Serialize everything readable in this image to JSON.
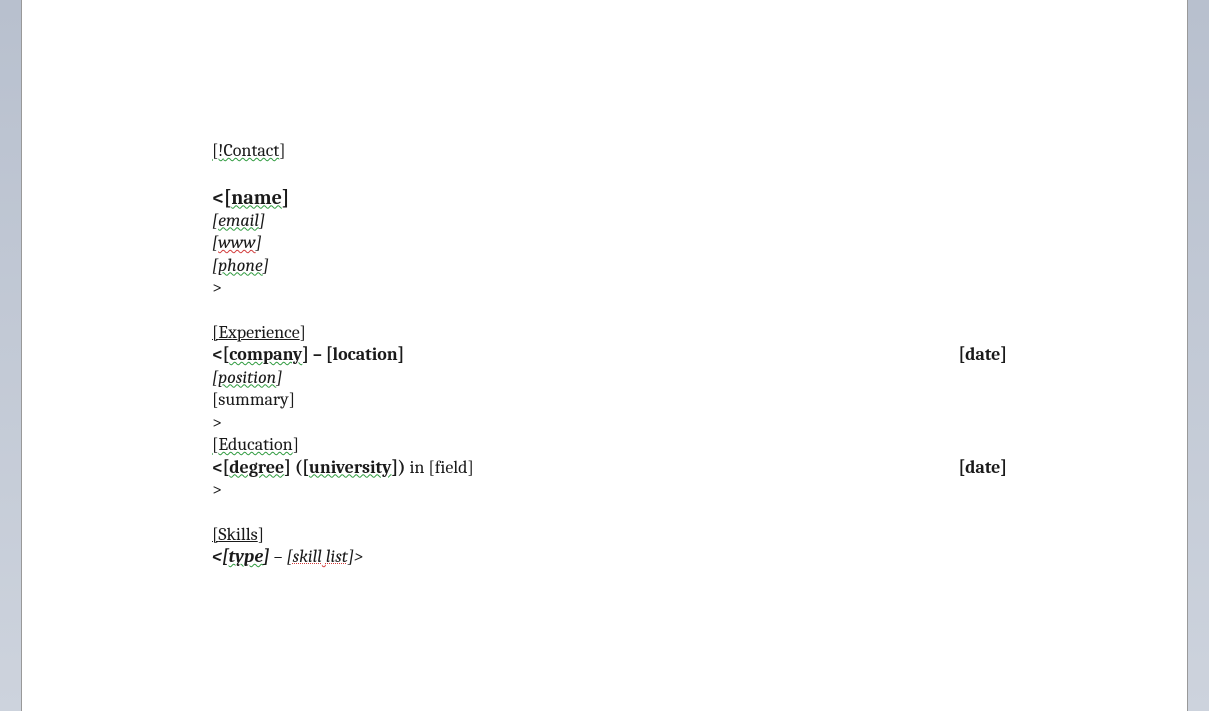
{
  "contact": {
    "header_prefix": "[!",
    "header_word": "Contact",
    "header_suffix": "]",
    "open": "<",
    "name_open": "[",
    "name_word": "name",
    "name_close": "]",
    "email_open": "[",
    "email_word": "email",
    "email_close": "]",
    "www_open": "[",
    "www_word": "www",
    "www_close": "]",
    "phone_open": "[",
    "phone_word": "phone",
    "phone_close": "]",
    "close": ">"
  },
  "experience": {
    "header_open": "[",
    "header_word": "Experience",
    "header_close": "]",
    "open": "<",
    "company_open": "[",
    "company_word": "company",
    "company_close": "]",
    "dash": " – ",
    "location": "[location]",
    "date": "[date]",
    "position_open": "[",
    "position_word": "position",
    "position_close": "]",
    "summary": "[summary]",
    "close": ">"
  },
  "education": {
    "header_open": "[",
    "header_word": "Education",
    "header_close": "]",
    "open": "<",
    "degree_open": "[",
    "degree_word": "degree",
    "degree_close": "]",
    "paren_open": " (",
    "university_open": "[",
    "university_word": "university",
    "university_close": "]",
    "paren_close": ") ",
    "in_field": "in [field]",
    "date": "[date]",
    "close": ">"
  },
  "skills": {
    "header_open": "[",
    "header_word": "Skills",
    "header_close": "]",
    "open": "<",
    "type_open": "[",
    "type_word": "type",
    "type_close": "]",
    "dash": " – ",
    "skill_open": "[",
    "skill_word1": "skill",
    "skill_space": " ",
    "skill_word2": "list",
    "skill_close": "]",
    "close": ">"
  }
}
